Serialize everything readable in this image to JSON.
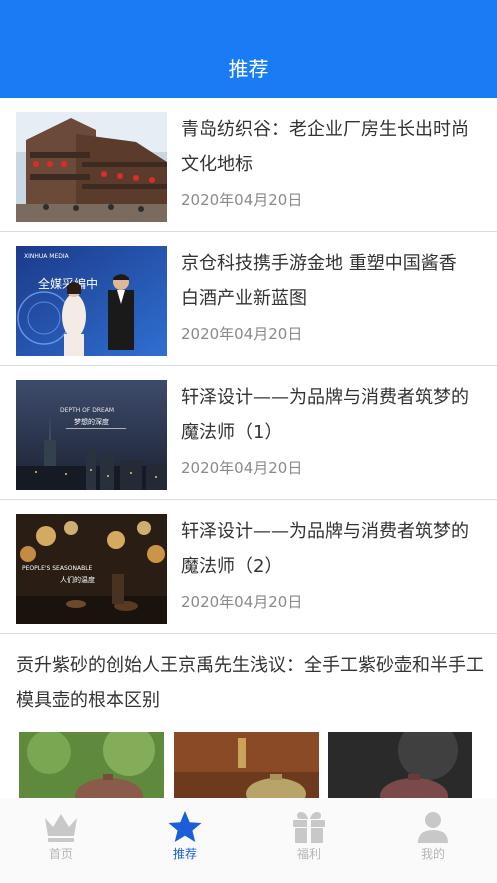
{
  "header": {
    "title": "推荐"
  },
  "articles": [
    {
      "title": "青岛纺织谷：老企业厂房生长出时尚文化地标",
      "date": "2020年04月20日"
    },
    {
      "title": "京仓科技携手游金地 重塑中国酱香白酒产业新蓝图",
      "date": "2020年04月20日"
    },
    {
      "title": "轩泽设计——为品牌与消费者筑梦的魔法师（1）",
      "date": "2020年04月20日"
    },
    {
      "title": "轩泽设计——为品牌与消费者筑梦的魔法师（2）",
      "date": "2020年04月20日"
    }
  ],
  "feature": {
    "title": "贡升紫砂的创始人王京禹先生浅议：全手工紫砂壶和半手工模具壶的根本区别"
  },
  "thumb_text": {
    "interview_logo": "XINHUA MEDIA",
    "interview_banner": "全媒采编中",
    "city_en": "DEPTH OF DREAM",
    "city_cn": "梦想的深度",
    "lantern_en": "PEOPLE'S SEASONABLE",
    "lantern_cn": "人们的温度"
  },
  "tabbar": {
    "items": [
      {
        "label": "首页",
        "icon": "crown-icon",
        "active": false
      },
      {
        "label": "推荐",
        "icon": "star-icon",
        "active": true
      },
      {
        "label": "福利",
        "icon": "gift-icon",
        "active": false
      },
      {
        "label": "我的",
        "icon": "user-icon",
        "active": false
      }
    ]
  },
  "colors": {
    "primary": "#1a7cf5",
    "tab_active": "#1b5ed8",
    "tab_inactive": "#c8c8c8",
    "date": "#8a8a8a"
  }
}
